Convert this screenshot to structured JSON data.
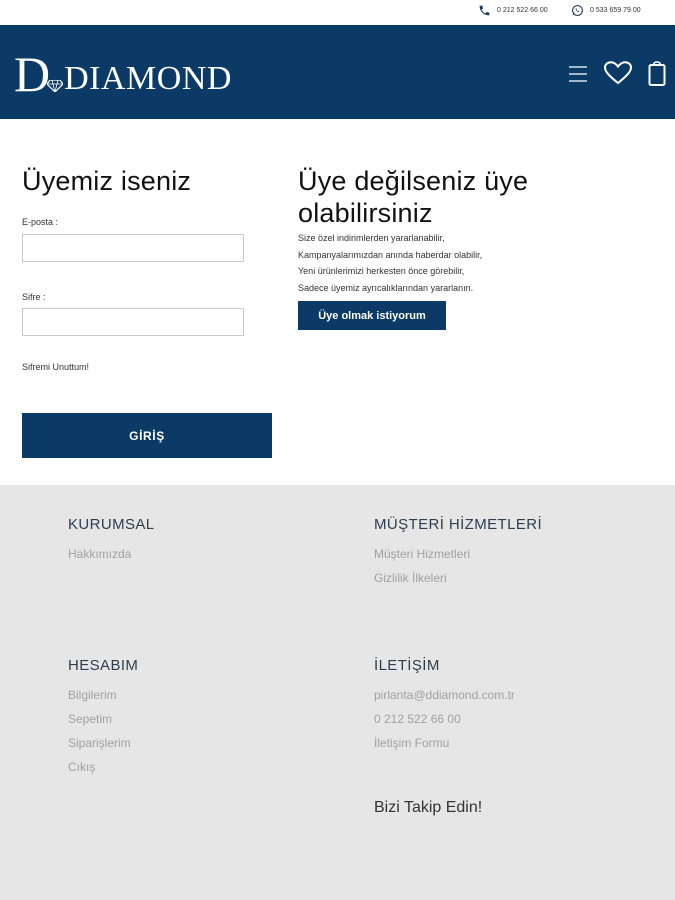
{
  "topbar": {
    "phone": "0 212 522 66 00",
    "whatsapp": "0 533 659 79 00",
    "icons": [
      "phone-icon",
      "whatsapp-icon"
    ]
  },
  "header": {
    "logo_initial": "D",
    "logo_rest": "DIAMOND",
    "icons": [
      "menu-icon",
      "heart-icon",
      "cart-icon"
    ],
    "bg_color": "#0b3a66"
  },
  "login": {
    "title": "Üyemiz iseniz",
    "email_label": "E-posta :",
    "email_value": "",
    "password_label": "Sifre :",
    "password_value": "",
    "forgot_link": "Sifremi Unuttum!",
    "submit_label": "GİRİŞ"
  },
  "register": {
    "title_line1": "Üye değilseniz üye",
    "title_line2": "olabilirsiniz",
    "benefits": [
      "Size özel indirimlerden yararlanabilir,",
      "Kampanyalarımızdan anında haberdar olabilir,",
      "Yeni ürünlerimizi herkesten önce görebilir,",
      "Sadece üyemiz ayrıcalıklarından yararlanın."
    ],
    "button_label": "Üye olmak istiyorum"
  },
  "footer": {
    "corporate": {
      "title": "KURUMSAL",
      "links": [
        "Hakkımızda"
      ]
    },
    "customer_service": {
      "title": "MÜŞTERİ HİZMETLERİ",
      "links": [
        "Müşteri Hizmetleri",
        "Gizlilik İlkeleri"
      ]
    },
    "account": {
      "title": "HESABIM",
      "links": [
        "Bilgilerim",
        "Sepetim",
        "Siparişlerim",
        "Cıkış"
      ]
    },
    "contact": {
      "title": "İLETİŞİM",
      "links": [
        "pirlanta@ddiamond.com.tr",
        "0 212 522 66 00",
        "İletişim Formu"
      ]
    },
    "follow_title": "Bizi Takip Edin!"
  }
}
